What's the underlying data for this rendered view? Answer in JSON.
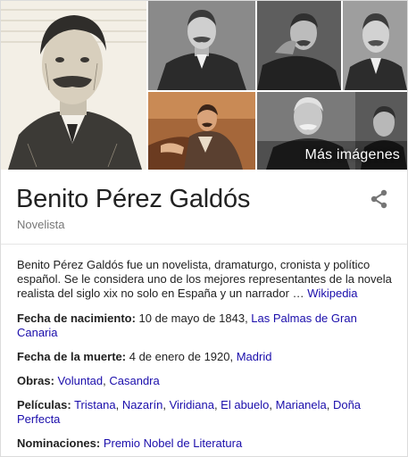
{
  "gallery": {
    "more_images_label": "Más imágenes"
  },
  "header": {
    "title": "Benito Pérez Galdós",
    "subtitle": "Novelista",
    "share_icon": "share-icon"
  },
  "description": {
    "text": "Benito Pérez Galdós fue un novelista, dramaturgo, cronista y político español. Se le considera uno de los mejores representantes de la novela realista del siglo xix no solo en España y un narrador … ",
    "source_link": "Wikipedia"
  },
  "facts": {
    "birth": {
      "label": "Fecha de nacimiento:",
      "value": " 10 de mayo de 1843, ",
      "link": "Las Palmas de Gran Canaria"
    },
    "death": {
      "label": "Fecha de la muerte:",
      "value": " 4 de enero de 1920, ",
      "link": "Madrid"
    },
    "works": {
      "label": "Obras:",
      "links": [
        "Voluntad",
        "Casandra"
      ]
    },
    "films": {
      "label": "Películas:",
      "links": [
        "Tristana",
        "Nazarín",
        "Viridiana",
        "El abuelo",
        "Marianela",
        "Doña Perfecta"
      ]
    },
    "nominations": {
      "label": "Nominaciones:",
      "link": "Premio Nobel de Literatura"
    }
  }
}
